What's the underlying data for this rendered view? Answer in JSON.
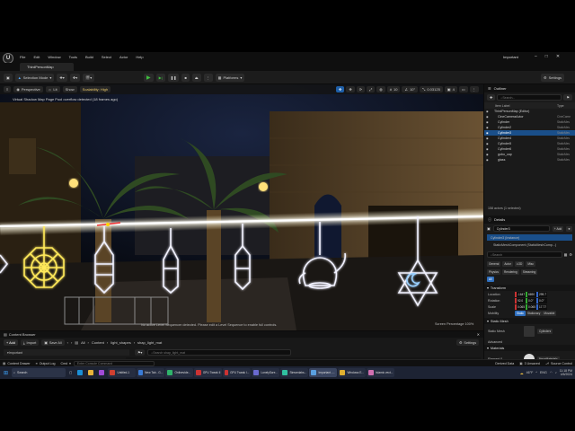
{
  "menu": [
    "File",
    "Edit",
    "Window",
    "Tools",
    "Build",
    "Select",
    "Actor",
    "Help"
  ],
  "project_name": "Important",
  "level_tab": "ThirdPersonMap",
  "toolbar": {
    "selection_mode": "Selection Mode",
    "platforms": "Platforms",
    "settings": "Settings"
  },
  "viewport": {
    "perspective": "Perspective",
    "lit": "Lit",
    "show": "Show",
    "scalability": "Scalability: High",
    "grid_value": "10",
    "angle_value": "10°",
    "scale_value": "0.03125",
    "camera_speed": "4",
    "warning": "Virtual Shadow Map Page Pool overflow detected (18 frames ago)",
    "sequencer_msg": "No active Level Sequencer detected. Please edit a Level Sequence to enable full controls.",
    "screen_pct": "Screen Percentage 100%"
  },
  "outliner": {
    "title": "Outliner",
    "search_placeholder": "Search...",
    "col_label": "Item Label",
    "col_type": "Type",
    "items": [
      {
        "name": "ThirdPersonMap (Editor)",
        "type": "",
        "selected": false,
        "indent": 1
      },
      {
        "name": "CineCameraActor",
        "type": "CineCame",
        "selected": false,
        "indent": 2
      },
      {
        "name": "Cylinder",
        "type": "StaticMes",
        "selected": false,
        "indent": 2
      },
      {
        "name": "Cylinder2",
        "type": "StaticMes",
        "selected": false,
        "indent": 2
      },
      {
        "name": "Cylinder3",
        "type": "StaticMes",
        "selected": true,
        "indent": 2
      },
      {
        "name": "Cylinder4",
        "type": "StaticMes",
        "selected": false,
        "indent": 2
      },
      {
        "name": "Cylinder5",
        "type": "StaticMes",
        "selected": false,
        "indent": 2
      },
      {
        "name": "Cylinder6",
        "type": "StaticMes",
        "selected": false,
        "indent": 2
      },
      {
        "name": "gobo_cap",
        "type": "StaticMes",
        "selected": false,
        "indent": 2
      },
      {
        "name": "glass",
        "type": "StaticMes",
        "selected": false,
        "indent": 2
      }
    ],
    "footer": "158 actors (1 selected)"
  },
  "details": {
    "title": "Details",
    "actor_name": "Cylinder3",
    "add_label": "+ Add",
    "instance_label": "Cylinder3 (Instance)",
    "component": "StaticMeshComponent (StaticMeshComp...)",
    "search_placeholder": "Search",
    "filters_row1": [
      "General",
      "Actor",
      "LOD",
      "Misc"
    ],
    "filters_row2": [
      "Physics",
      "Rendering",
      "Streaming"
    ],
    "filter_all": "All",
    "transform_title": "Transform",
    "location_label": "Location",
    "location": [
      "-1647",
      "6690",
      "299.7"
    ],
    "rotation_label": "Rotation",
    "rotation": [
      "92.0",
      "0.0°",
      "0.0°"
    ],
    "scale_label": "Scale",
    "scale": [
      "0.065",
      "0.065",
      "17.77"
    ],
    "mobility_label": "Mobility",
    "mobility": [
      "Static",
      "Stationary",
      "Movable"
    ],
    "static_mesh_title": "Static Mesh",
    "static_mesh_label": "Static Mesh",
    "static_mesh_value": "Cylinder",
    "advanced": "Advanced",
    "materials_title": "Materials",
    "element0_label": "Element 0",
    "element0_value": "NeonMaterial",
    "advanced2": "Advanced",
    "physics_title": "Physics"
  },
  "content_browser": {
    "tab": "Content Browser",
    "add": "+ Add",
    "import": "Import",
    "save_all": "Save All",
    "path": [
      "All",
      "Content",
      "light_shapes",
      "shap_light_mat"
    ],
    "settings": "Settings",
    "favorites": "Important",
    "collections": "Collections",
    "search_placeholder": "Search shap_light_mat",
    "items_count": "17 items"
  },
  "status_bar": {
    "content_drawer": "Content Drawer",
    "output_log": "Output Log",
    "cmd": "Cmd",
    "cmd_placeholder": "Enter Console Command",
    "derived_data": "Derived Data",
    "unsaved": "3 Unsaved",
    "source_control": "Source Control"
  },
  "taskbar": {
    "search": "Search",
    "apps": [
      "Untitled-1",
      "New Tab - G...",
      "Onlinevide...",
      "GPU Tweak II",
      "GPU Tweak I...",
      "LonelyScre...",
      "Streamlabs...",
      "Important -...",
      "Windows E...",
      "Islamic vect..."
    ],
    "temp": "46°F",
    "lang": "ENG",
    "time": "11:18 PM",
    "date": "4/6/2024"
  }
}
